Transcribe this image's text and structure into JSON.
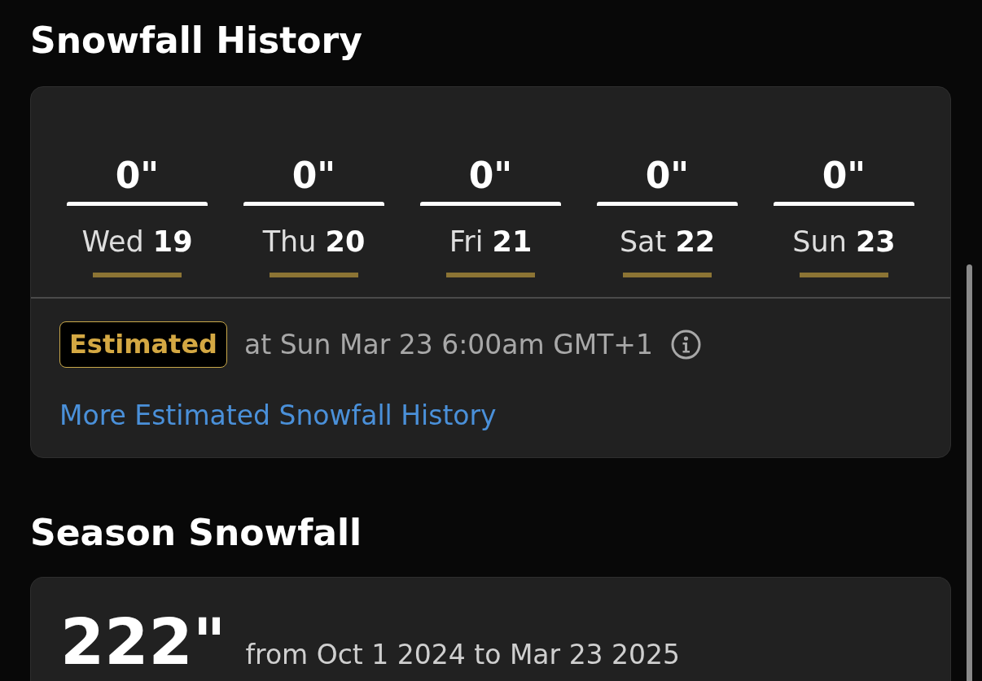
{
  "snowfall_history": {
    "title": "Snowfall History",
    "days": [
      {
        "amount": "0\"",
        "label": "Wed **19**",
        "estimated": true
      },
      {
        "amount": "0\"",
        "label": "Thu **20**",
        "estimated": true
      },
      {
        "amount": "0\"",
        "label": "Fri **21**",
        "estimated": true
      },
      {
        "amount": "0\"",
        "label": "Sat **22**",
        "estimated": true
      },
      {
        "amount": "0\"",
        "label": "Sun **23**",
        "estimated": true
      }
    ],
    "badge": "Estimated",
    "timestamp": "at Sun Mar 23 6:00am GMT+1",
    "link": "More Estimated Snowfall History"
  },
  "season_snowfall": {
    "title": "Season Snowfall",
    "total": "222\"",
    "range": "from Oct 1 2024 to Mar 23 2025"
  }
}
